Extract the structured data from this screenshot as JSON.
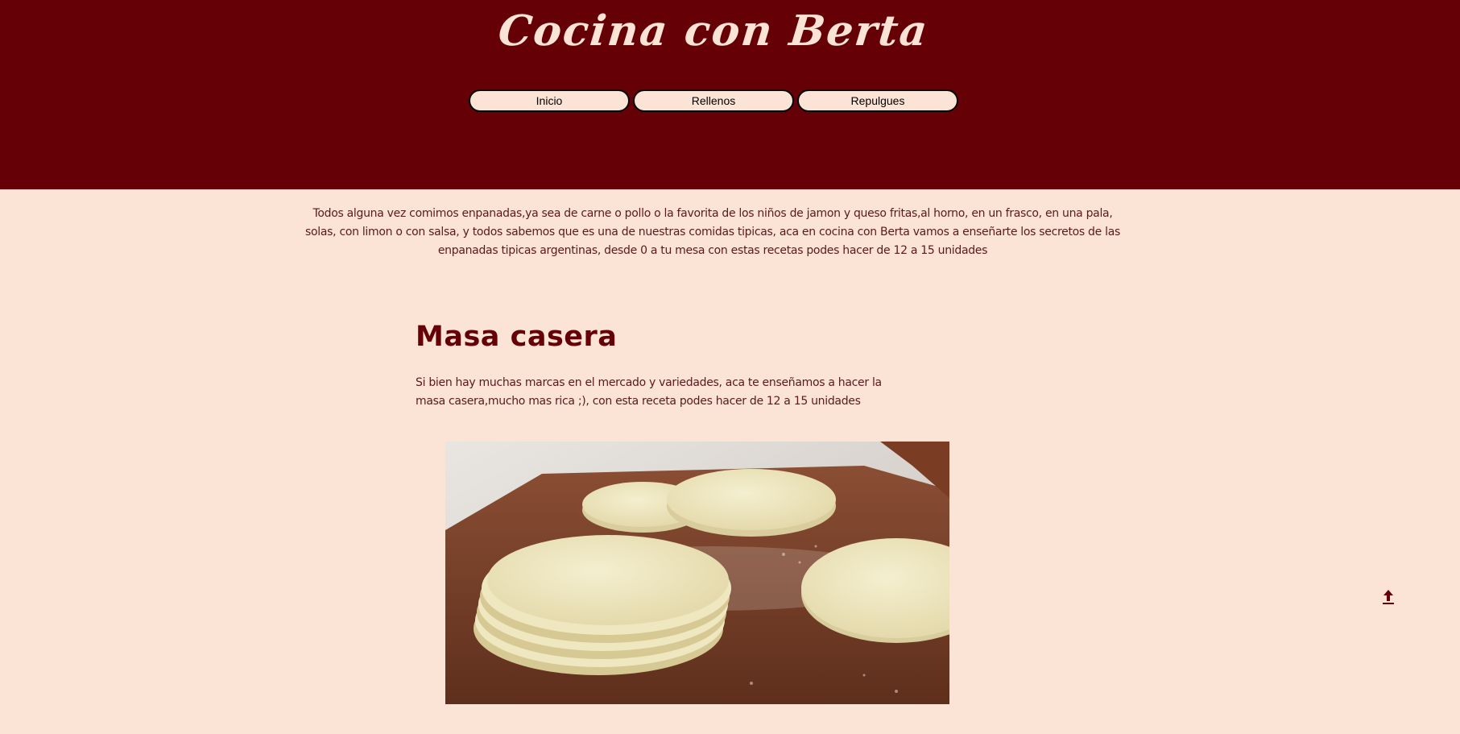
{
  "header": {
    "site_title": "Cocina con Berta",
    "nav": [
      {
        "label": "Inicio"
      },
      {
        "label": "Rellenos"
      },
      {
        "label": "Repulgues"
      }
    ]
  },
  "main": {
    "intro": "Todos alguna vez comimos enpanadas,ya sea de carne o pollo o la favorita de los niños de jamon y queso fritas,al horno, en un frasco, en una pala, solas, con limon o con salsa, y todos sabemos que es una de nuestras comidas tipicas, aca en cocina con Berta vamos a enseñarte los secretos de las enpanadas tipicas argentinas, desde 0 a tu mesa con estas recetas podes hacer de 12 a 15 unidades",
    "section": {
      "title": "Masa casera",
      "description": "Si bien hay muchas marcas en el mercado y variedades, aca te enseñamos a hacer la masa casera,mucho mas rica ;), con esta receta podes hacer de 12 a 15 unidades"
    }
  },
  "icons": {
    "back_to_top": "arrow-up-icon"
  },
  "colors": {
    "header_bg": "#660007",
    "page_bg": "#fbe3d6",
    "title_text": "#fbe3d6",
    "heading_text": "#660007",
    "body_text": "#5a1a1a"
  }
}
